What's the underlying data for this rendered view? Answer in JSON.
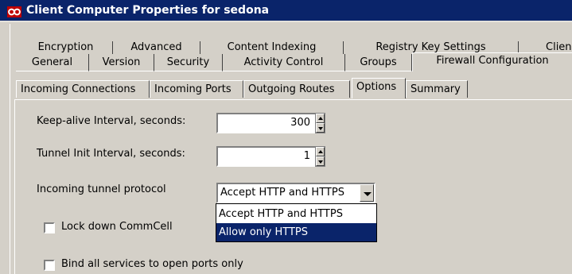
{
  "window": {
    "title": "Client Computer Properties for sedona",
    "icon": "infinity-logo-icon",
    "title_bar_color": "#0a246a"
  },
  "tabs": {
    "row1": [
      "Encryption",
      "Advanced",
      "Content Indexing",
      "Registry Key Settings",
      "Clien"
    ],
    "row2": [
      "General",
      "Version",
      "Security",
      "Activity Control",
      "Groups",
      "Firewall Configuration"
    ],
    "active": "Firewall Configuration"
  },
  "inner_tabs": {
    "items": [
      "Incoming Connections",
      "Incoming Ports",
      "Outgoing Routes",
      "Options",
      "Summary"
    ],
    "active": "Options"
  },
  "options": {
    "keepalive": {
      "label": "Keep-alive Interval, seconds:",
      "value": "300"
    },
    "tunnel_init": {
      "label": "Tunnel Init Interval, seconds:",
      "value": "1"
    },
    "protocol": {
      "label": "Incoming tunnel protocol",
      "selected": "Accept HTTP and HTTPS",
      "options": [
        "Accept HTTP and HTTPS",
        "Allow only HTTPS"
      ],
      "highlighted": "Allow only HTTPS"
    },
    "lockdown": {
      "label": "Lock down CommCell",
      "checked": false
    },
    "bind_ports": {
      "label": "Bind all services to open ports only",
      "checked": false
    }
  },
  "colors": {
    "highlight": "#0a246a",
    "face": "#d4d0c8"
  }
}
